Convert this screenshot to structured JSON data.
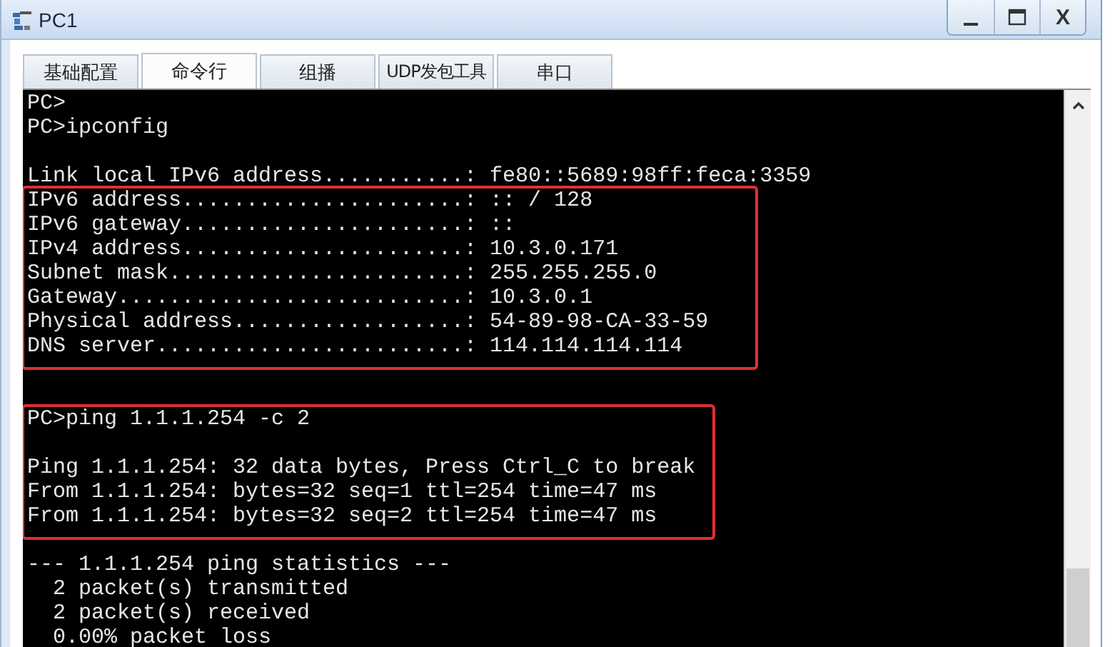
{
  "window": {
    "title": "PC1",
    "controls": [
      {
        "kind": "minimize"
      },
      {
        "kind": "maximize"
      },
      {
        "kind": "close",
        "label": "X"
      }
    ]
  },
  "tabs": [
    {
      "label": "基础配置",
      "selected": false
    },
    {
      "label": "命令行",
      "selected": true
    },
    {
      "label": "组播",
      "selected": false
    },
    {
      "label": "UDP发包工具",
      "selected": false
    },
    {
      "label": "串口",
      "selected": false
    }
  ],
  "terminal": {
    "sections": [
      {
        "highlighted": false,
        "lines": [
          {
            "kind": "text",
            "text": "PC>"
          },
          {
            "kind": "text",
            "text": "PC>ipconfig"
          },
          {
            "kind": "blank"
          },
          {
            "kind": "text",
            "text": "Link local IPv6 address...........: fe80::5689:98ff:feca:3359"
          }
        ]
      },
      {
        "highlighted": true,
        "lines": [
          {
            "kind": "text",
            "text": "IPv6 address......................: :: / 128"
          },
          {
            "kind": "text",
            "text": "IPv6 gateway......................: ::"
          },
          {
            "kind": "text",
            "text": "IPv4 address......................: 10.3.0.171"
          },
          {
            "kind": "text",
            "text": "Subnet mask.......................: 255.255.255.0"
          },
          {
            "kind": "text",
            "text": "Gateway...........................: 10.3.0.1"
          },
          {
            "kind": "text",
            "text": "Physical address..................: 54-89-98-CA-33-59"
          },
          {
            "kind": "text",
            "text": "DNS server........................: 114.114.114.114"
          }
        ]
      },
      {
        "highlighted": false,
        "lines": [
          {
            "kind": "blank"
          },
          {
            "kind": "blank"
          }
        ]
      },
      {
        "highlighted": true,
        "lines": [
          {
            "kind": "text",
            "text": "PC>ping 1.1.1.254 -c 2"
          },
          {
            "kind": "blank"
          },
          {
            "kind": "text",
            "text": "Ping 1.1.1.254: 32 data bytes, Press Ctrl_C to break"
          },
          {
            "kind": "text",
            "text": "From 1.1.1.254: bytes=32 seq=1 ttl=254 time=47 ms"
          },
          {
            "kind": "text",
            "text": "From 1.1.1.254: bytes=32 seq=2 ttl=254 time=47 ms"
          }
        ]
      },
      {
        "highlighted": false,
        "lines": [
          {
            "kind": "blank"
          },
          {
            "kind": "text",
            "text": "--- 1.1.1.254 ping statistics ---"
          },
          {
            "kind": "text",
            "text": "  2 packet(s) transmitted"
          },
          {
            "kind": "text",
            "text": "  2 packet(s) received"
          },
          {
            "kind": "text",
            "text": "  0.00% packet loss"
          }
        ]
      }
    ]
  }
}
